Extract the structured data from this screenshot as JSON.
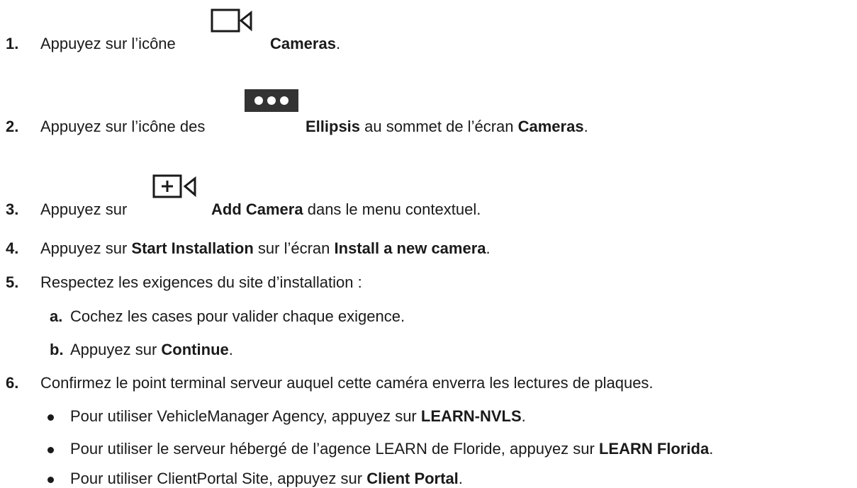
{
  "steps": [
    {
      "num": "1.",
      "parts": [
        "Appuyez sur l’icône",
        "Cameras",
        "."
      ],
      "icon": "video-camera-icon"
    },
    {
      "num": "2.",
      "parts": [
        "Appuyez sur l’icône des",
        "Ellipsis",
        "au sommet de l’écran",
        "Cameras",
        "."
      ],
      "icon": "ellipsis-icon"
    },
    {
      "num": "3.",
      "parts": [
        "Appuyez sur",
        "Add Camera",
        "dans le menu contextuel."
      ],
      "icon": "add-camera-icon"
    },
    {
      "num": "4.",
      "parts": [
        "Appuyez sur",
        "Start Installation",
        "sur l’écran",
        "Install a new camera",
        "."
      ]
    },
    {
      "num": "5.",
      "parts": [
        "Respectez les exigences du site d’installation :"
      ]
    },
    {
      "num": "6.",
      "parts": [
        "Confirmez le point terminal serveur auquel cette caméra enverra les lectures de plaques."
      ]
    }
  ],
  "substeps": [
    {
      "num": "a.",
      "parts": [
        "Cochez les cases pour valider chaque exigence."
      ]
    },
    {
      "num": "b.",
      "parts": [
        "Appuyez sur",
        "Continue",
        "."
      ]
    }
  ],
  "bullets": [
    {
      "parts": [
        "Pour utiliser VehicleManager Agency, appuyez sur",
        "LEARN-NVLS",
        "."
      ]
    },
    {
      "parts": [
        "Pour utiliser le serveur hébergé de l’agence LEARN de Floride, appuyez sur",
        "LEARN Florida",
        "."
      ]
    },
    {
      "parts": [
        "Pour utiliser ClientPortal Site, appuyez sur",
        "Client Portal",
        "."
      ]
    }
  ]
}
